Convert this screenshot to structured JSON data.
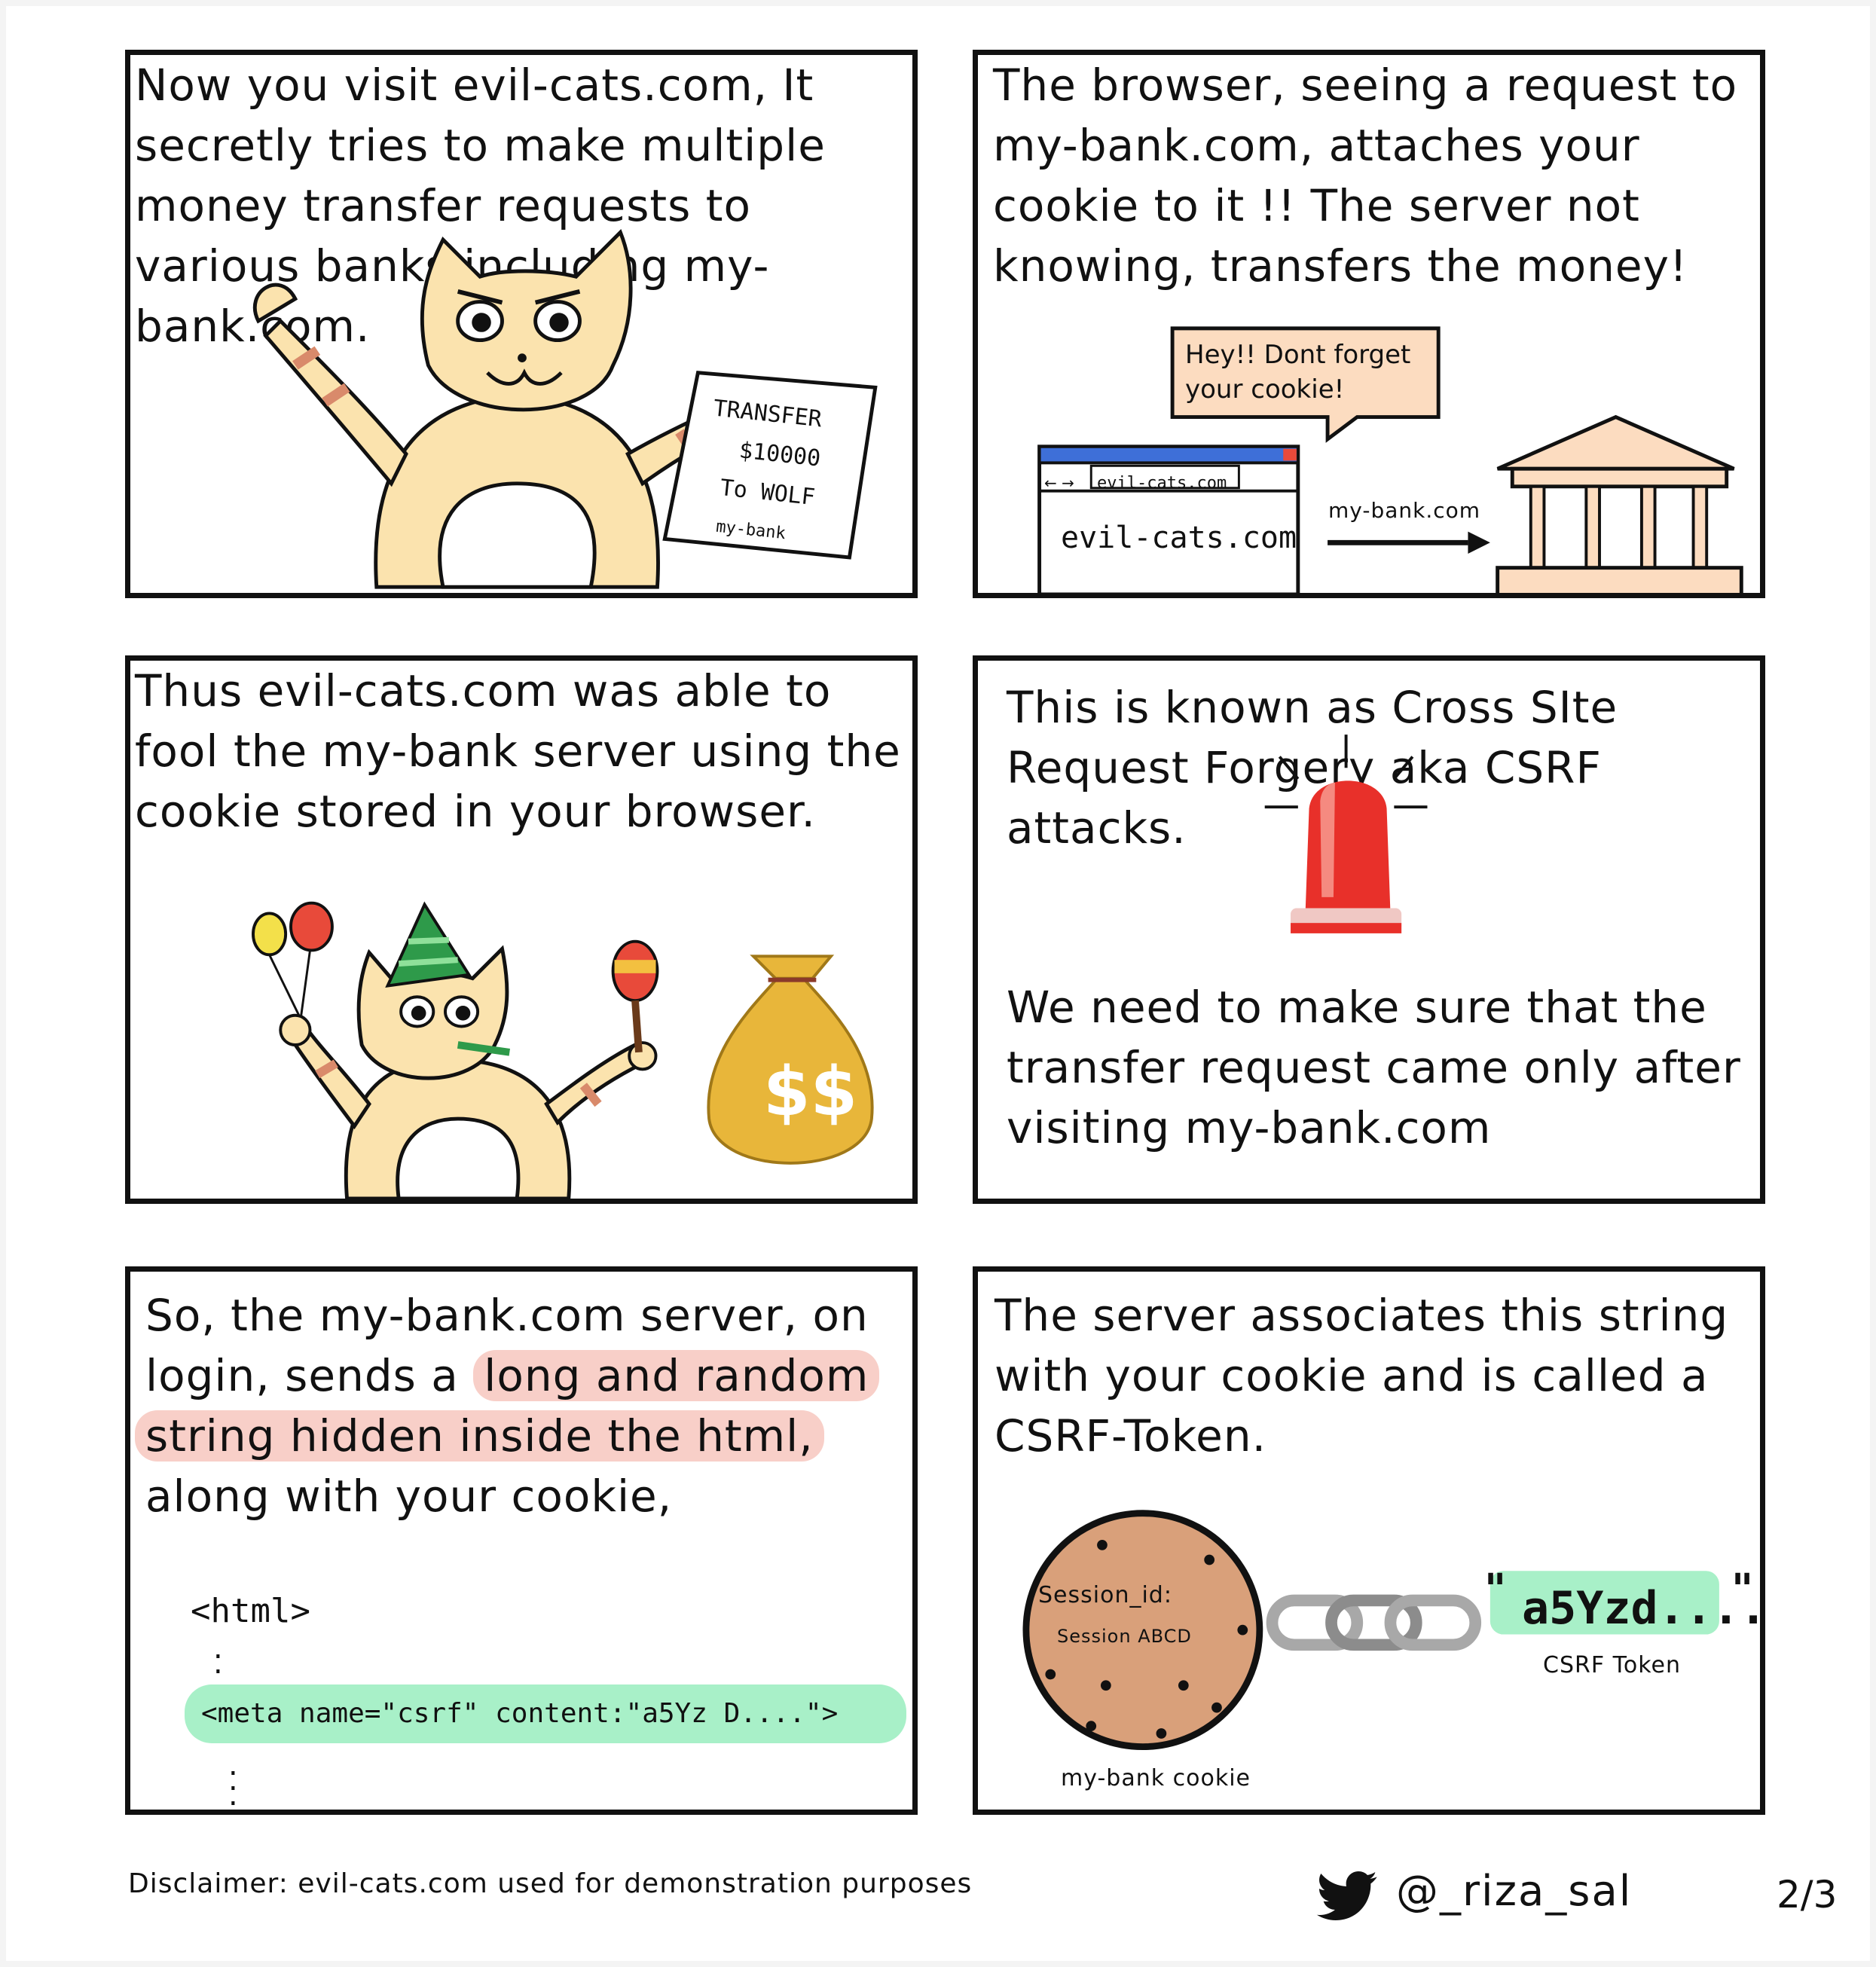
{
  "panels": {
    "p1": {
      "text": "Now you visit evil-cats.com, It secretly tries to make multiple money transfer requests to various banks including my-bank.com.",
      "note": {
        "line1": "TRANSFER",
        "line2": "$10000",
        "line3": "To WOLF",
        "line4": "my-bank"
      }
    },
    "p2": {
      "text": "The browser, seeing a request to my-bank.com, attaches your cookie to it !! The server not knowing, transfers the money!",
      "speech": {
        "line1": "Hey!! Dont forget",
        "line2": "your cookie!"
      },
      "browser_url": "evil-cats.com",
      "browser_page_text": "evil-cats.com",
      "arrow_label": "my-bank.com"
    },
    "p3": {
      "text": "Thus evil-cats.com was able to fool the my-bank server using the cookie stored in your browser.",
      "bag_symbol": "$$"
    },
    "p4": {
      "text_top": "This is known as Cross SIte Request Forgery aka CSRF attacks.",
      "text_bottom": "We need to make sure that the transfer request came only after visiting my-bank.com"
    },
    "p5": {
      "line1_pre": "So, the my-bank.com server, on",
      "line2_pre": "login, sends a ",
      "line2_hl": "long and random",
      "line3_hl": "string hidden inside the html,",
      "line4": "along with your cookie,",
      "code_open": "<html>",
      "code_meta": "<meta name=\"csrf\" content:\"a5Yz D....\">"
    },
    "p6": {
      "text": "The server associates this string with your cookie and is called a CSRF-Token.",
      "cookie_line1": "Session_id:",
      "cookie_line2": "Session ABCD",
      "cookie_label": "my-bank cookie",
      "token_text": "a5Yzd....",
      "token_open_quote": "\"",
      "token_close_quote": "\"",
      "token_label": "CSRF Token"
    }
  },
  "footer": {
    "disclaimer": "Disclaimer: evil-cats.com used for demonstration purposes",
    "handle": "@_riza_sal",
    "page": "2/3"
  },
  "colors": {
    "highlight_pink": "#f8cfc8",
    "highlight_green": "#a8f0c8",
    "cat": "#fbe3ae",
    "cookie": "#d9a07a",
    "siren": "#e8302a",
    "twitter": "#111111"
  }
}
